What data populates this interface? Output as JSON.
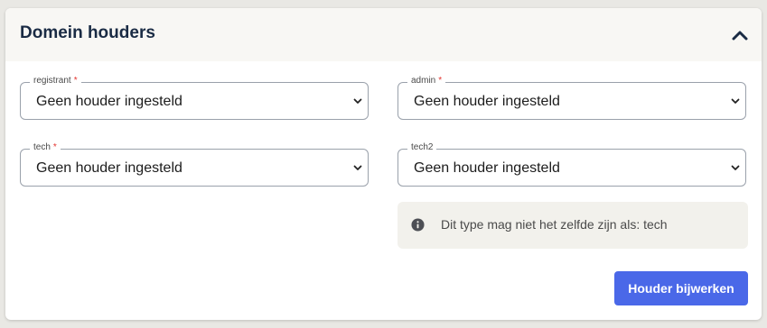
{
  "card": {
    "title": "Domein houders",
    "collapse_icon": "chevron-up-icon"
  },
  "fields": {
    "registrant": {
      "label": "registrant",
      "required_mark": "*",
      "value": "Geen houder ingesteld"
    },
    "admin": {
      "label": "admin",
      "required_mark": "*",
      "value": "Geen houder ingesteld"
    },
    "tech": {
      "label": "tech",
      "required_mark": "*",
      "value": "Geen houder ingesteld"
    },
    "tech2": {
      "label": "tech2",
      "value": "Geen houder ingesteld"
    }
  },
  "info": {
    "icon": "info-circle-icon",
    "text": "Dit type mag niet het zelfde zijn als: tech"
  },
  "actions": {
    "submit_label": "Houder bijwerken"
  },
  "colors": {
    "accent": "#4a68e8",
    "required": "#e3342f",
    "title": "#1a2b44",
    "info_bg": "#f2f1ec"
  }
}
